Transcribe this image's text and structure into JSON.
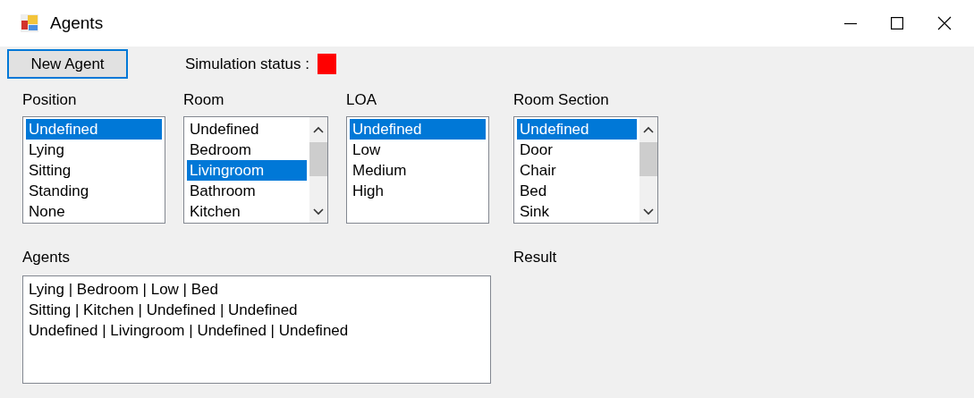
{
  "window": {
    "title": "Agents"
  },
  "toolbar": {
    "new_agent_button": "New Agent",
    "status_label": "Simulation status :",
    "indicator": {
      "color": "#ff0000"
    }
  },
  "lists": [
    {
      "label": "Position",
      "scrollbar": false,
      "items": [
        {
          "text": "Undefined",
          "selected": true
        },
        {
          "text": "Lying",
          "selected": false
        },
        {
          "text": "Sitting",
          "selected": false
        },
        {
          "text": "Standing",
          "selected": false
        },
        {
          "text": "None",
          "selected": false
        }
      ]
    },
    {
      "label": "Room",
      "scrollbar": true,
      "items": [
        {
          "text": "Undefined",
          "selected": false
        },
        {
          "text": "Bedroom",
          "selected": false
        },
        {
          "text": "Livingroom",
          "selected": true
        },
        {
          "text": "Bathroom",
          "selected": false
        },
        {
          "text": "Kitchen",
          "selected": false
        }
      ]
    },
    {
      "label": "LOA",
      "scrollbar": false,
      "items": [
        {
          "text": "Undefined",
          "selected": true
        },
        {
          "text": "Low",
          "selected": false
        },
        {
          "text": "Medium",
          "selected": false
        },
        {
          "text": "High",
          "selected": false
        }
      ]
    },
    {
      "label": "Room Section",
      "scrollbar": true,
      "items": [
        {
          "text": "Undefined",
          "selected": true
        },
        {
          "text": "Door",
          "selected": false
        },
        {
          "text": "Chair",
          "selected": false
        },
        {
          "text": "Bed",
          "selected": false
        },
        {
          "text": "Sink",
          "selected": false
        }
      ]
    }
  ],
  "agents": {
    "label": "Agents",
    "lines": [
      "Lying | Bedroom | Low | Bed",
      "Sitting | Kitchen | Undefined | Undefined",
      "Undefined | Livingroom | Undefined | Undefined"
    ]
  },
  "result": {
    "label": "Result"
  }
}
